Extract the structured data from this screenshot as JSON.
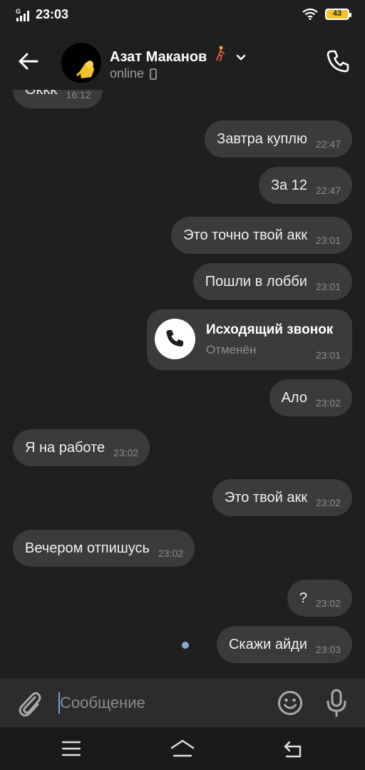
{
  "status_bar": {
    "time": "23:03",
    "network": "G",
    "battery": "43"
  },
  "header": {
    "contact_name": "Азат Маканов",
    "status": "online"
  },
  "messages": {
    "top_partial": {
      "text": "Okkk",
      "time": "16:12"
    },
    "m1": {
      "text": "Завтра куплю",
      "time": "22:47"
    },
    "m2": {
      "text": "За 12",
      "time": "22:47"
    },
    "m3": {
      "text": "Это точно твой акк",
      "time": "23:01"
    },
    "m4": {
      "text": "Пошли в лобби",
      "time": "23:01"
    },
    "call": {
      "title": "Исходящий звонок",
      "subtitle": "Отменён",
      "time": "23:01"
    },
    "m5": {
      "text": "Ало",
      "time": "23:02"
    },
    "m6": {
      "text": "Я на работе",
      "time": "23:02"
    },
    "m7": {
      "text": "Это твой акк",
      "time": "23:02"
    },
    "m8": {
      "text": "Вечером отпишусь",
      "time": "23:02"
    },
    "m9": {
      "text": "?",
      "time": "23:02"
    },
    "m10": {
      "text": "Скажи айди",
      "time": "23:03"
    }
  },
  "composer": {
    "placeholder": "Сообщение"
  },
  "colors": {
    "background": "#1f1f1f",
    "bubble": "#3b3b3b",
    "accent": "#86a8d6",
    "battery": "#f2c230"
  },
  "icons": [
    "signal-icon",
    "wifi-icon",
    "battery-icon",
    "back-arrow-icon",
    "chevron-down-icon",
    "phone-icon",
    "paperclip-icon",
    "emoji-icon",
    "microphone-icon",
    "menu-icon",
    "home-icon",
    "back-icon"
  ]
}
